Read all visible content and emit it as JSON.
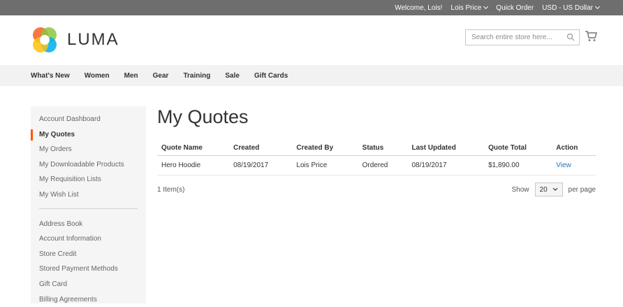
{
  "topbar": {
    "welcome": "Welcome, Lois!",
    "account": "Lois Price",
    "quick_order": "Quick Order",
    "currency": "USD - US Dollar"
  },
  "header": {
    "logo_text": "LUMA",
    "search_placeholder": "Search entire store here..."
  },
  "nav": {
    "items": [
      "What's New",
      "Women",
      "Men",
      "Gear",
      "Training",
      "Sale",
      "Gift Cards"
    ]
  },
  "sidebar": {
    "group1": [
      "Account Dashboard",
      "My Quotes",
      "My Orders",
      "My Downloadable Products",
      "My Requisition Lists",
      "My Wish List"
    ],
    "group2": [
      "Address Book",
      "Account Information",
      "Store Credit",
      "Stored Payment Methods",
      "Gift Card",
      "Billing Agreements"
    ]
  },
  "main": {
    "title": "My Quotes",
    "columns": [
      "Quote Name",
      "Created",
      "Created By",
      "Status",
      "Last Updated",
      "Quote Total",
      "Action"
    ],
    "rows": [
      [
        "Hero Hoodie",
        "08/19/2017",
        "Lois Price",
        "Ordered",
        "08/19/2017",
        "$1,890.00",
        "View"
      ]
    ],
    "item_count": "1 Item(s)",
    "show_label": "Show",
    "per_page_value": "20",
    "per_page_label": "per page"
  },
  "colors": {
    "topbar_bg": "#6e6e6e",
    "nav_bg": "#f2f2f2",
    "active_accent": "#ff5501",
    "link": "#1979c3"
  }
}
